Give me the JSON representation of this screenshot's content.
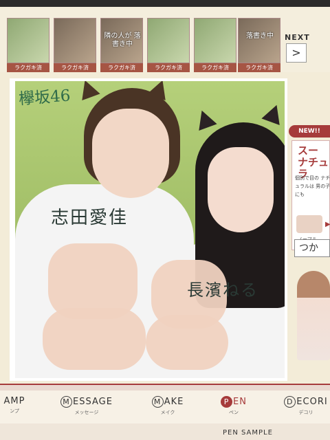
{
  "thumbnails": [
    {
      "overlay": "",
      "caption": "ラクガキ済",
      "tone": "light"
    },
    {
      "overlay": "",
      "caption": "ラクガキ済",
      "tone": "dark"
    },
    {
      "overlay": "隣の人が 落書き中",
      "caption": "ラクガキ済",
      "tone": "dark"
    },
    {
      "overlay": "",
      "caption": "ラクガキ済",
      "tone": "light"
    },
    {
      "overlay": "",
      "caption": "ラクガキ済",
      "tone": "light"
    },
    {
      "overlay": "落書き中",
      "caption": "ラクガキ済",
      "tone": "dark"
    }
  ],
  "next": {
    "label": "NEXT",
    "arrow": ">"
  },
  "photo": {
    "group_name": "欅坂46",
    "name_left": "志田愛佳",
    "name_right": "長濱ねる"
  },
  "side": {
    "badge": "NEW!!",
    "title_line1": "スー",
    "title_line2": "ナチュラ",
    "desc": "個別で目の ナチュラルは 男の子にも",
    "eye_label": "ノーマル",
    "arrow": "▶",
    "button": "つか"
  },
  "tabs": [
    {
      "label": "AMP",
      "letter": "",
      "sub": "ンプ",
      "active": false
    },
    {
      "label": "ESSAGE",
      "letter": "M",
      "sub": "メッセージ",
      "active": false
    },
    {
      "label": "AKE",
      "letter": "M",
      "sub": "メイク",
      "active": false
    },
    {
      "label": "EN",
      "letter": "P",
      "sub": "ペン",
      "active": true
    },
    {
      "label": "ECORI",
      "letter": "D",
      "sub": "デコリ",
      "active": false
    }
  ],
  "pen_sample": "PEN SAMPLE",
  "colors": {
    "accent": "#a63b3b",
    "background": "#f3ecd8"
  }
}
